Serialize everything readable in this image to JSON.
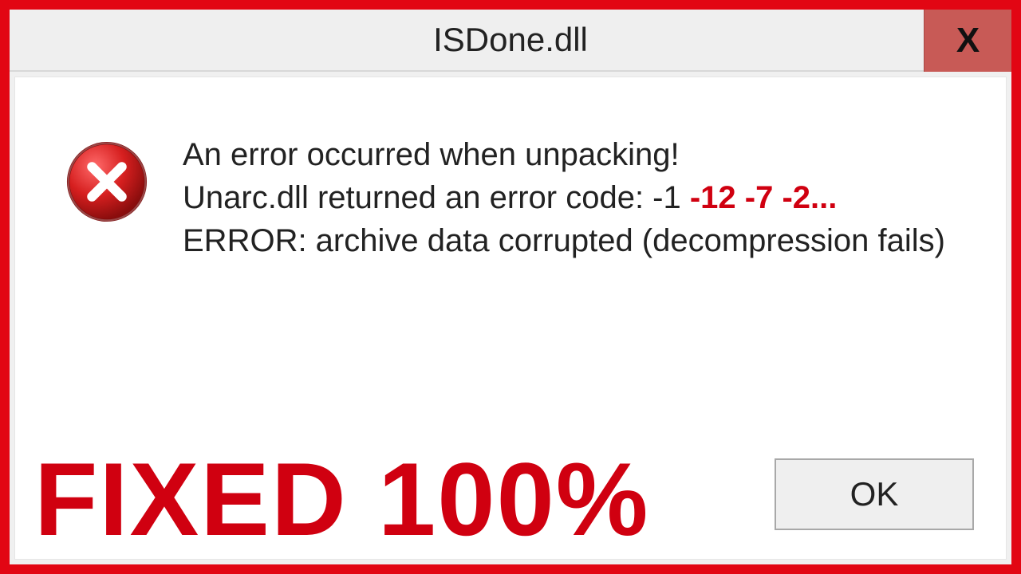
{
  "dialog": {
    "title": "ISDone.dll",
    "close_glyph": "X",
    "message": {
      "line1": "An error occurred when unpacking!",
      "line2_prefix": "Unarc.dll returned an error code: -1 ",
      "line2_codes": "-12 -7 -2...",
      "line3": "ERROR: archive data corrupted (decompression fails)"
    },
    "ok_label": "OK"
  },
  "overlay": {
    "fixed_text": "FIXED 100%"
  },
  "colors": {
    "accent_red": "#d00010",
    "frame_red": "#e20613",
    "close_bg": "#c85a56"
  }
}
